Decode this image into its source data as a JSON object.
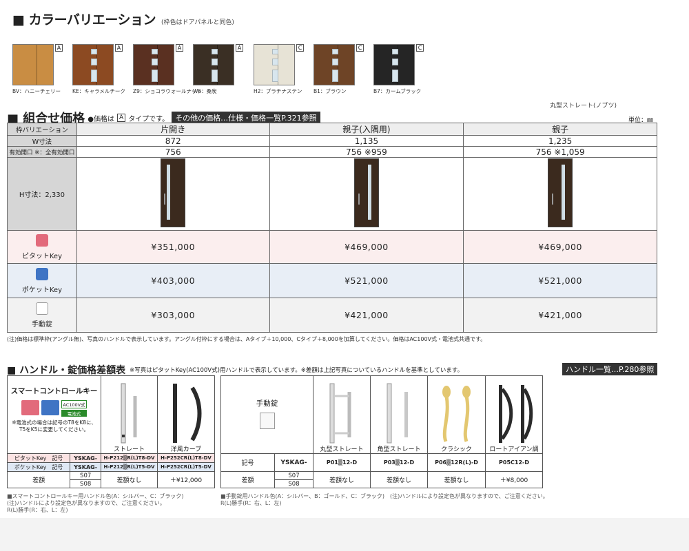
{
  "section1": {
    "title": "■ カラーバリエーション",
    "note": "(枠色はドアパネルと同色)",
    "swatches": [
      {
        "label": "BV：ハニーチェリー",
        "tag": "A",
        "color": "#c98d43"
      },
      {
        "label": "KE：キャラメルチーク",
        "tag": "A",
        "color": "#8c4a22"
      },
      {
        "label": "Z9：ショコラウォールナット",
        "tag": "A",
        "color": "#5a3021"
      },
      {
        "label": "W6：桑炭",
        "tag": "A",
        "color": "#3a2f24"
      },
      {
        "label": "H2：プラチナステン",
        "tag": "C",
        "color": "#e7e3d6"
      },
      {
        "label": "B1：ブラウン",
        "tag": "C",
        "color": "#6e4426"
      },
      {
        "label": "B7：カームブラック",
        "tag": "C",
        "color": "#252525"
      }
    ]
  },
  "section2": {
    "title": "■ 組合せ価格",
    "note": "●価格は",
    "note_tag": "A",
    "note_after": "タイプです。",
    "ref_tag": "その他の価格…仕様・価格一覧P.321参照",
    "top_right_note": "丸型ストレート(ノブツ)",
    "unit": "単位：㎜",
    "headers": {
      "variation": "枠バリエーション",
      "w": "W寸法",
      "opening": "有効開口 ※：全有効開口",
      "h": "H寸法：2,330"
    },
    "columns": [
      {
        "name": "片開き",
        "w": "872",
        "opening": "756"
      },
      {
        "name": "親子(入隅用)",
        "w": "1,135",
        "opening": "756 ※959"
      },
      {
        "name": "親子",
        "w": "1,235",
        "opening": "756 ※1,059"
      }
    ],
    "rows": [
      {
        "label": "ピタットKey",
        "icon_label": "ピタットKey",
        "icon_color": "#e26a7b",
        "prices": [
          "¥351,000",
          "¥469,000",
          "¥469,000"
        ]
      },
      {
        "label": "ポケットKey",
        "icon_label": "ポケットKey",
        "icon_color": "#3f74c4",
        "prices": [
          "¥403,000",
          "¥521,000",
          "¥521,000"
        ]
      },
      {
        "label": "手動錠",
        "icon_label": "手動錠",
        "icon_color": "#888888",
        "prices": [
          "¥303,000",
          "¥421,000",
          "¥421,000"
        ]
      }
    ],
    "footnote": "(注)価格は標準枠(アングル無)、写真のハンドルで表示しています。アングル付枠にする場合は、Aタイプ＋10,000、Cタイプ＋8,000を加算してください。価格はAC100V式・電池式共通です。"
  },
  "section3": {
    "title": "■ ハンドル・錠価格差額表",
    "note": "※写真はピタットKey(AC100V式)用ハンドルで表示しています。※差額は上記写真についているハンドルを基準としています。",
    "ref_tag": "ハンドル一覧…P.280参照",
    "smart": {
      "title": "スマートコントロールキー",
      "badge1": "AC100V式",
      "badge2": "電池式",
      "icon1": "ピタットKey",
      "icon2": "ポケットKey",
      "battery_note": "※電池式の場合は記号のT8をK8に、T5をK5に変更してください。",
      "handles": [
        "ストレート",
        "洋風カーブ"
      ],
      "row_pitat": {
        "label": "ピタットKey　記号",
        "prefix": "YSKAG-",
        "codes": [
          "H-P212▒R(L)T8-DV",
          "H-P252CR(L)T8-DV"
        ]
      },
      "row_pocket": {
        "label": "ポケットKey　記号",
        "prefix": "YSKAG-",
        "codes": [
          "H-P212▒R(L)T5-DV",
          "H-P252CR(L)T5-DV"
        ]
      },
      "diff_label": "差額",
      "s_codes": [
        "S07",
        "S08"
      ],
      "diffs": [
        "差額なし",
        "＋¥12,000"
      ],
      "footnote1": "■スマートコントロールキー用ハンドル色(A：シルバー、C：ブラック)",
      "footnote2": "(注)ハンドルにより設定色が異なりますので、ご注意ください。",
      "footnote3": "R(L)勝手(R：右、L：左)"
    },
    "manual": {
      "title": "手動錠",
      "icon_label": "手動錠",
      "handles": [
        "丸型ストレート",
        "角型ストレート",
        "クラシック",
        "ロートアイアン調"
      ],
      "code_label": "記号",
      "prefix": "YSKAG-",
      "codes": [
        "P01▒12-D",
        "P03▒12-D",
        "P06▒12R(L)-D",
        "P05C12-D"
      ],
      "diff_label": "差額",
      "s_codes": [
        "S07",
        "S08"
      ],
      "diffs": [
        "差額なし",
        "差額なし",
        "差額なし",
        "＋¥8,000"
      ],
      "footnote1": "■手動錠用ハンドル色(A：シルバー、B：ゴールド、C：ブラック)　(注)ハンドルにより設定色が異なりますので、ご注意ください。",
      "footnote2": "R(L)勝手(R：右、L：左)"
    }
  }
}
